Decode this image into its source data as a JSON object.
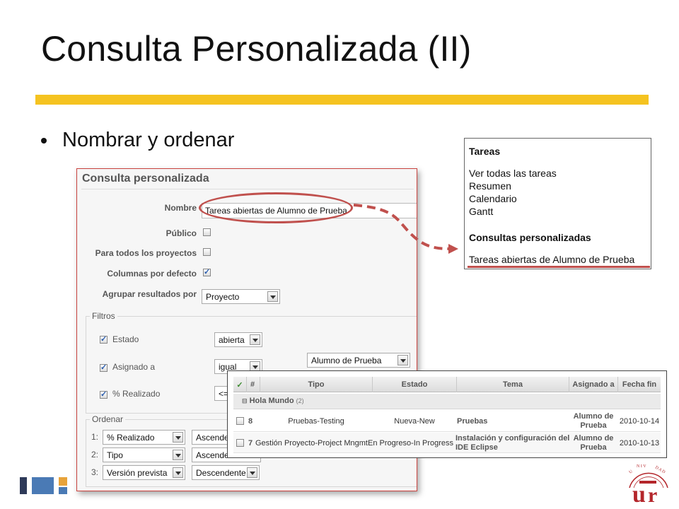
{
  "slide": {
    "title": "Consulta Personalizada (II)",
    "bullet": "Nombrar y ordenar"
  },
  "form": {
    "heading": "Consulta personalizada",
    "nombre_label": "Nombre",
    "nombre_value": "Tareas abiertas de Alumno de Prueba",
    "publico_label": "Público",
    "todos_label": "Para todos los proyectos",
    "columnas_label": "Columnas por defecto",
    "agrupar_label": "Agrupar resultados por",
    "agrupar_value": "Proyecto",
    "filtros_legend": "Filtros",
    "filters": [
      {
        "label": "Estado",
        "operator": "abierta"
      },
      {
        "label": "Asignado a",
        "operator": "igual",
        "value": "Alumno de Prueba"
      },
      {
        "label": "% Realizado",
        "operator": "<="
      }
    ],
    "ordenar_legend": "Ordenar",
    "sort": [
      {
        "num": "1:",
        "field": "% Realizado",
        "dir": "Ascende"
      },
      {
        "num": "2:",
        "field": "Tipo",
        "dir": "Ascende"
      },
      {
        "num": "3:",
        "field": "Versión prevista",
        "dir": "Descendente"
      }
    ]
  },
  "menu": {
    "section1": "Tareas",
    "items": [
      "Ver todas las tareas",
      "Resumen",
      "Calendario",
      "Gantt"
    ],
    "section2": "Consultas personalizadas",
    "custom_item": "Tareas abiertas de Alumno de Prueba"
  },
  "table": {
    "headers": [
      "✓",
      "#",
      "Tipo",
      "Estado",
      "Tema",
      "Asignado a",
      "Fecha fin"
    ],
    "group_name": "Hola Mundo",
    "group_count": "(2)",
    "rows": [
      {
        "id": "8",
        "tipo": "Pruebas-Testing",
        "estado": "Nueva-New",
        "tema": "Pruebas",
        "asignado_1": "Alumno de",
        "asignado_2": "Prueba",
        "fecha": "2010-10-14"
      },
      {
        "id": "7",
        "tipo": "Gestión Proyecto-Project Mngmt",
        "estado": "En Progreso-In Progress",
        "tema_1": "Instalación y configuración del",
        "tema_2": "IDE Eclipse",
        "asignado_1": "Alumno de",
        "asignado_2": "Prueba",
        "fecha": "2010-10-13"
      }
    ]
  },
  "colors": {
    "accent_yellow": "#f5c320",
    "highlight_red": "#c0504d",
    "logo_blue": "#4a7ab5",
    "logo_navy": "#2e3a59",
    "logo_orange": "#e8a33a"
  }
}
